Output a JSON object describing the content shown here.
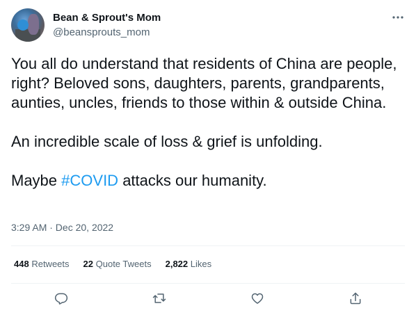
{
  "author": {
    "display_name": "Bean & Sprout's Mom",
    "handle": "@beansprouts_mom"
  },
  "tweet": {
    "paragraph1": "You all do understand that residents of China are people, right? Beloved sons, daughters, parents, grandparents, aunties, uncles, friends to those within & outside China.",
    "paragraph2": "An incredible scale of loss & grief is unfolding.",
    "paragraph3_before": "Maybe ",
    "hashtag": "#COVID",
    "paragraph3_after": " attacks our humanity.",
    "timestamp": "3:29 AM · Dec 20, 2022"
  },
  "stats": {
    "retweets_count": "448",
    "retweets_label": "Retweets",
    "quotes_count": "22",
    "quotes_label": "Quote Tweets",
    "likes_count": "2,822",
    "likes_label": "Likes"
  },
  "colors": {
    "text_primary": "#0f1419",
    "text_secondary": "#536471",
    "accent": "#1d9bf0",
    "divider": "#eff3f4"
  },
  "icons": {
    "more": "more-horizontal-icon",
    "reply": "reply-icon",
    "retweet": "retweet-icon",
    "like": "like-icon",
    "share": "share-icon"
  }
}
